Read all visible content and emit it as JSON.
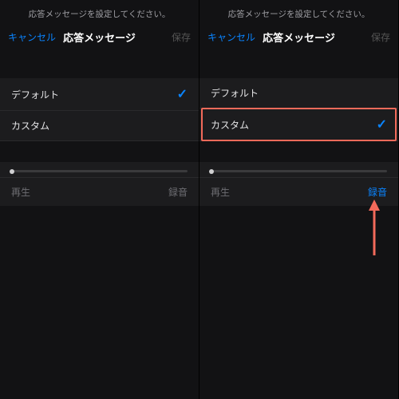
{
  "left": {
    "instruction": "応答メッセージを設定してください。",
    "nav": {
      "cancel": "キャンセル",
      "title": "応答メッセージ",
      "save": "保存"
    },
    "options": {
      "default": {
        "label": "デフォルト",
        "selected": true
      },
      "custom": {
        "label": "カスタム",
        "selected": false
      }
    },
    "controls": {
      "play": "再生",
      "record": "録音",
      "record_active": false
    }
  },
  "right": {
    "instruction": "応答メッセージを設定してください。",
    "nav": {
      "cancel": "キャンセル",
      "title": "応答メッセージ",
      "save": "保存"
    },
    "options": {
      "default": {
        "label": "デフォルト",
        "selected": false
      },
      "custom": {
        "label": "カスタム",
        "selected": true
      }
    },
    "controls": {
      "play": "再生",
      "record": "録音",
      "record_active": true
    }
  },
  "checkmark": "✓"
}
